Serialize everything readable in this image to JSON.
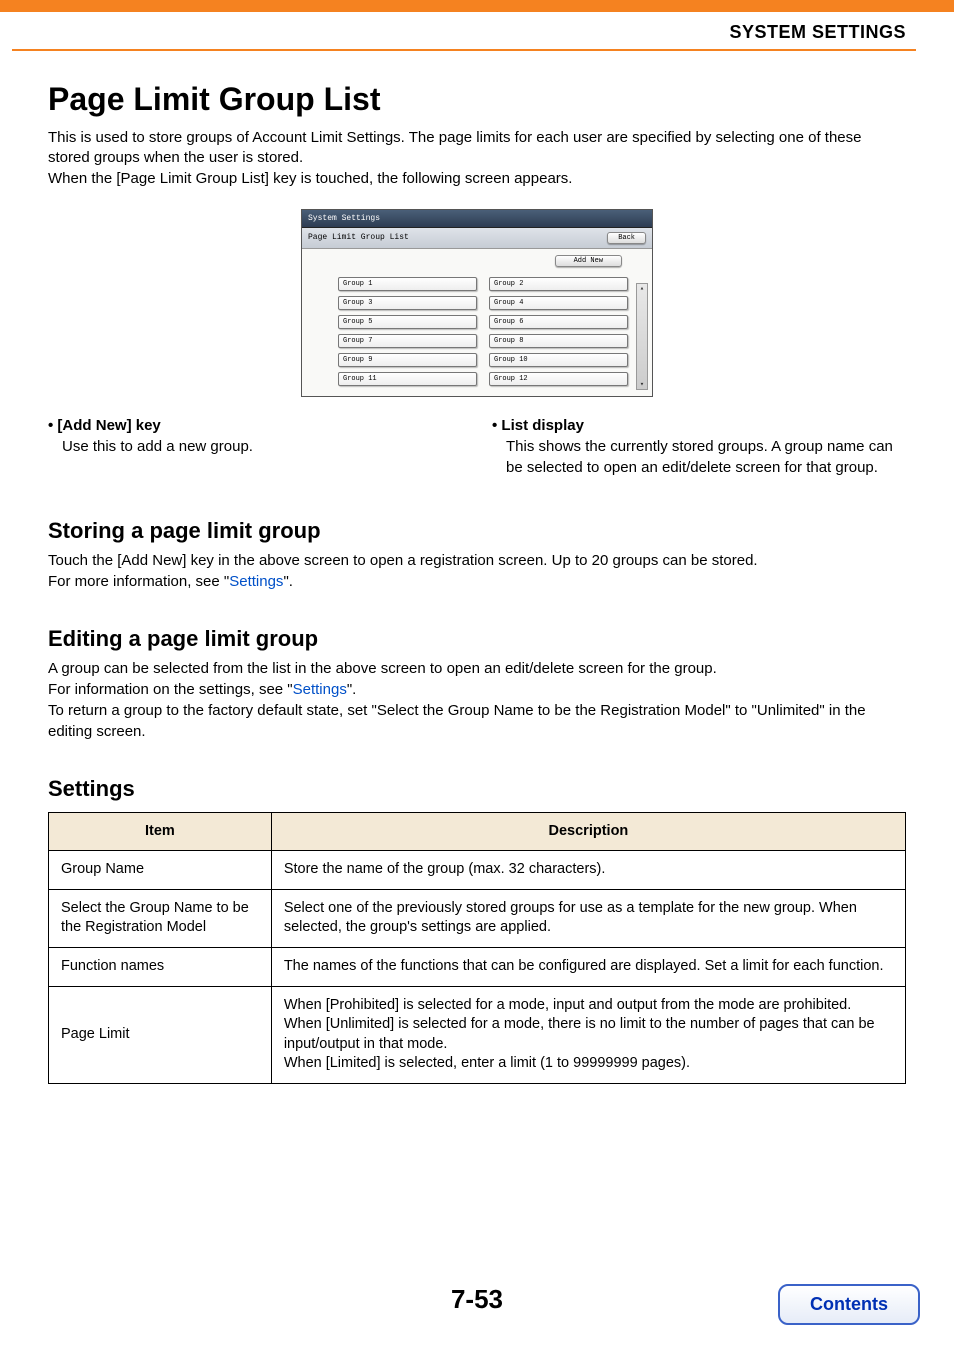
{
  "header": {
    "section": "SYSTEM SETTINGS"
  },
  "title": "Page Limit Group List",
  "intro": "This is used to store groups of Account Limit Settings. The page limits for each user are specified by selecting one of these stored groups when the user is stored.\nWhen the [Page Limit Group List] key is touched, the following screen appears.",
  "mockup": {
    "titlebar": "System Settings",
    "subtitle": "Page Limit Group List",
    "back": "Back",
    "addnew": "Add New",
    "groups": [
      "Group 1",
      "Group 2",
      "Group 3",
      "Group 4",
      "Group 5",
      "Group 6",
      "Group 7",
      "Group 8",
      "Group 9",
      "Group 10",
      "Group 11",
      "Group 12"
    ]
  },
  "bullets": {
    "left_title": "• [Add New] key",
    "left_desc": "Use this to add a new group.",
    "right_title": "• List display",
    "right_desc": "This shows the currently stored groups. A group name can be selected to open an edit/delete screen for that group."
  },
  "storing": {
    "heading": "Storing a page limit group",
    "text1": "Touch the [Add New] key in the above screen to open a registration screen. Up to 20 groups can be stored.",
    "text2_prefix": "For more information, see \"",
    "text2_link": "Settings",
    "text2_suffix": "\"."
  },
  "editing": {
    "heading": "Editing a page limit group",
    "line1": "A group can be selected from the list in the above screen to open an edit/delete screen for the group.",
    "line2_prefix": "For information on the settings, see \"",
    "line2_link": "Settings",
    "line2_suffix": "\".",
    "line3": "To return a group to the factory default state, set \"Select the Group Name to be the Registration Model\" to \"Unlimited\" in the editing screen."
  },
  "settings": {
    "heading": "Settings",
    "col_item": "Item",
    "col_desc": "Description",
    "rows": [
      {
        "item": "Group Name",
        "desc": "Store the name of the group (max. 32 characters)."
      },
      {
        "item": "Select the Group Name to be the Registration Model",
        "desc": "Select one of the previously stored groups for use as a template for the new group. When selected, the group's settings are applied."
      },
      {
        "item": "Function names",
        "desc": "The names of the functions that can be configured are displayed. Set a limit for each function."
      },
      {
        "item": "Page Limit",
        "desc": "When [Prohibited] is selected for a mode, input and output from the mode are prohibited.\nWhen [Unlimited] is selected for a mode, there is no limit to the number of pages that can be input/output in that mode.\nWhen [Limited] is selected, enter a limit (1 to 99999999 pages)."
      }
    ]
  },
  "footer": {
    "page": "7-53",
    "contents": "Contents"
  }
}
